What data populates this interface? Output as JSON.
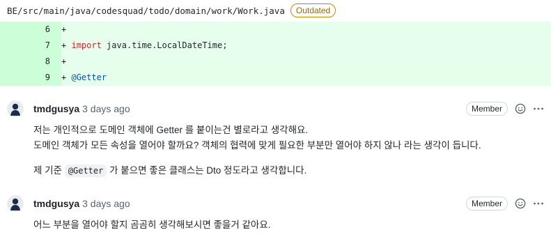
{
  "file": {
    "path": "BE/src/main/java/codesquad/todo/domain/work/Work.java",
    "badge": "Outdated"
  },
  "diff": [
    {
      "num": "6",
      "prefix": "+",
      "keyword": "",
      "rest": "",
      "annotation": ""
    },
    {
      "num": "7",
      "prefix": "+",
      "keyword": "import",
      "rest": " java.time.LocalDateTime;",
      "annotation": ""
    },
    {
      "num": "8",
      "prefix": "+",
      "keyword": "",
      "rest": "",
      "annotation": ""
    },
    {
      "num": "9",
      "prefix": "+",
      "keyword": "",
      "rest": "",
      "annotation": "@Getter"
    }
  ],
  "comments": [
    {
      "author": "tmdgusya",
      "time": "3 days ago",
      "role": "Member",
      "line1": "저는 개인적으로 도메인 객체에 Getter 를 붙이는건 별로라고 생각해요.",
      "line2": "도메인 객체가 모든 속성을 열어야 할까요? 객체의 협력에 맞게 필요한 부분만 열어야 하지 않나 라는 생각이 듭니다.",
      "line3_pre": "제 기준 ",
      "line3_code": "@Getter",
      "line3_post": " 가 붙으면 좋은 클래스는 Dto 정도라고 생각합니다."
    },
    {
      "author": "tmdgusya",
      "time": "3 days ago",
      "role": "Member",
      "line1": "어느 부분을 열어야 할지 곰곰히 생각해보시면 좋을거 같아요."
    }
  ],
  "icons": [
    "smiley-icon",
    "kebab-menu-icon",
    "avatar"
  ]
}
